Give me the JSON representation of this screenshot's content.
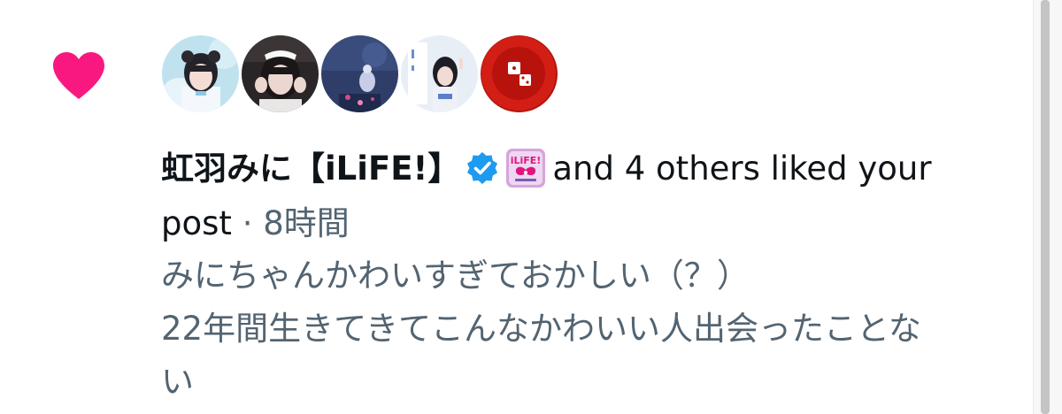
{
  "notification": {
    "type_icon": "heart-icon",
    "accent_color": "#f91880",
    "avatars": [
      {
        "icon": "avatar-user-1"
      },
      {
        "icon": "avatar-user-2"
      },
      {
        "icon": "avatar-user-3"
      },
      {
        "icon": "avatar-user-4"
      },
      {
        "icon": "avatar-user-5"
      }
    ],
    "username": "虹羽みに【iLiFE!】",
    "verified_badge": "verified-icon",
    "affiliate_badge": "iLiFE-label-icon",
    "action_text": "and 4 others liked your post",
    "separator": "·",
    "timestamp": "8時間",
    "post_lines": [
      "みにちゃんかわいすぎておかしい（？）",
      "22年間生きてきてこんなかわいい人出会ったことな",
      "い"
    ]
  }
}
